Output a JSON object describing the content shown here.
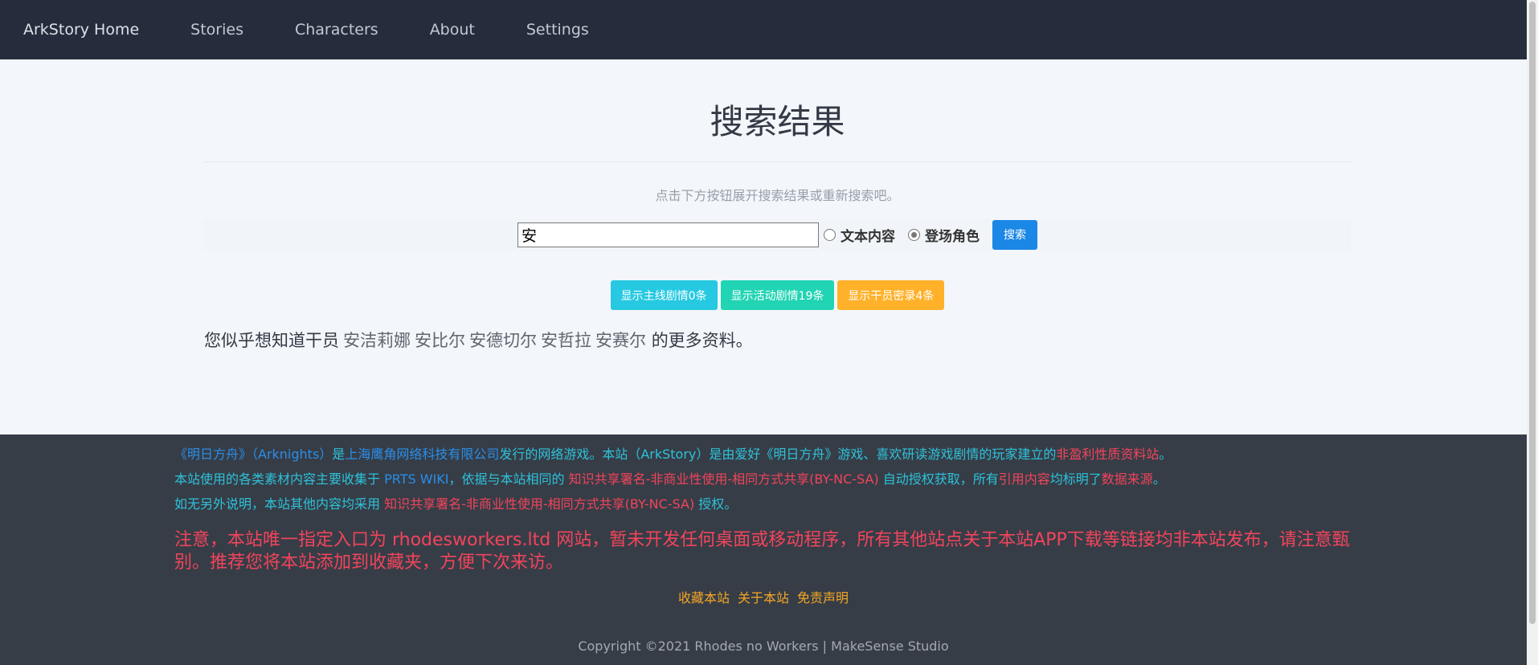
{
  "nav": [
    "ArkStory Home",
    "Stories",
    "Characters",
    "About",
    "Settings"
  ],
  "title": "搜索结果",
  "subtitle": "点击下方按钮展开搜索结果或重新搜索吧。",
  "search": {
    "value": "安",
    "options": [
      "文本内容",
      "登场角色"
    ],
    "selected": "登场角色",
    "button": "搜索",
    "button_color": "#1b87e6"
  },
  "results": [
    {
      "label": "显示主线剧情0条",
      "color": "#26c9e1"
    },
    {
      "label": "显示活动剧情19条",
      "color": "#21d4b4"
    },
    {
      "label": "显示干员密录4条",
      "color": "#ffb12a"
    }
  ],
  "hint": {
    "prefix": "您似乎想知道干员",
    "operators": [
      "安洁莉娜",
      "安比尔",
      "安德切尔",
      "安哲拉",
      "安赛尔"
    ],
    "suffix": "的更多资料。"
  },
  "footer": {
    "line1": [
      "《明日方舟》（Arknights）",
      "是",
      "上海鹰角网络科技有限公司",
      "发行的网络游戏。本站（ArkStory）",
      "是由爱好《明日方舟》游戏、喜欢研读游戏剧情的玩家建立的",
      "非盈利性质资料站",
      "。"
    ],
    "line2": [
      "本站使用的各类素材内容主要收集于 ",
      "PRTS WIKI",
      "，依据与本站相同的 ",
      "知识共享署名-非商业性使用-相同方式共享(BY-NC-SA)",
      " 自动授权获取，所有",
      "引用内容",
      "均标明了",
      "数据来源",
      "。"
    ],
    "line3": [
      "如无另外说明，本站其他内容均采用 ",
      "知识共享署名-非商业性使用-相同方式共享(BY-NC-SA)",
      " 授权。"
    ],
    "warning": "注意，本站唯一指定入口为 rhodesworkers.ltd 网站，暂未开发任何桌面或移动程序，所有其他站点关于本站APP下载等链接均非本站发布，请注意甄别。推荐您将本站添加到收藏夹，方便下次来访。",
    "links": [
      "收藏本站",
      "关于本站",
      "免责声明"
    ],
    "copyright": "Copyright ©2021 Rhodes no Workers | MakeSense Studio"
  }
}
